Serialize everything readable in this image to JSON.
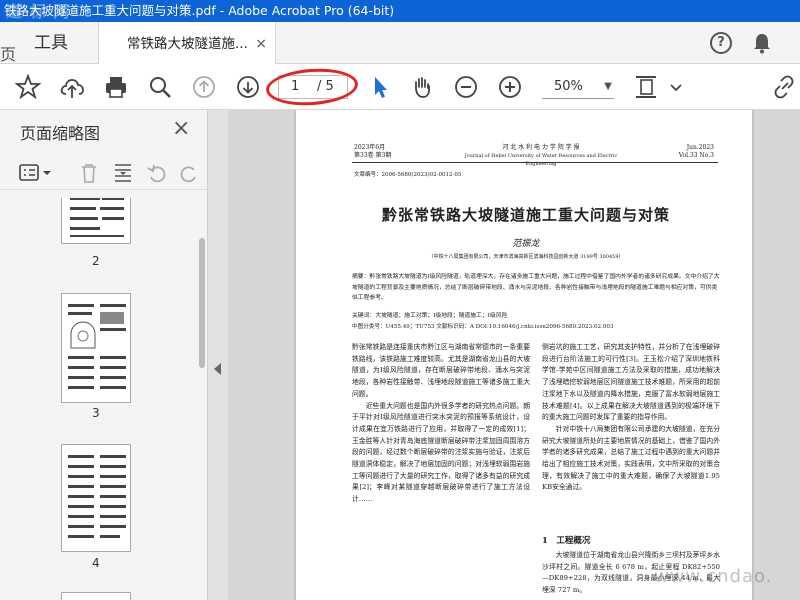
{
  "window": {
    "title": "铁路大坡隧道施工重大问题与对策.pdf - Adobe Acrobat Pro (64-bit)",
    "watermark_text": "道 标 网"
  },
  "tabs": {
    "tools_label": "工具",
    "doc_label": "常铁路大坡隧道施...",
    "close_glyph": "×",
    "help_glyph": "?"
  },
  "toolbar": {
    "current_page": "1",
    "total_pages": "/ 5",
    "zoom": "50%",
    "zoom_chevron": "▼"
  },
  "sidebar": {
    "title": "页面缩略图",
    "close_glyph": "×",
    "thumbnails": [
      {
        "label": "2"
      },
      {
        "label": "3"
      },
      {
        "label": "4"
      }
    ]
  },
  "document": {
    "header_left": [
      "2023年6月",
      "第33卷 第3期"
    ],
    "header_center": [
      "河 北 水 利 电 力 学 院 学 报",
      "Journal of Hebei University of Water Resources and Electric Engineering"
    ],
    "header_right": [
      "Jun.2023",
      "Vol.33 No.3"
    ],
    "article_no": "文章编号：2096-5680(2023)02-0012-05",
    "title": "黔张常铁路大坡隧道施工重大问题与对策",
    "author": "范振龙",
    "affiliation": "（中铁十八局集团有限公司，天津市滨海高新区滨海科技园创新大道 3199号 300459）",
    "abstract": "摘要：黔张常铁路大坡隧道为Ⅰ级风险隧道，轨道埋深大，存在诸多施工重大问题，施工过程中借鉴了国内外学者的诸多研究成果。文中介绍了大坡隧道的工程背景及主要地质情况，总结了断层破碎带地段、涌水与突泥地段、各种岩性接触带与浅埋地段的隧道施工难题与相应对策，可供类似工程参考。",
    "keywords": "关键词：大坡隧道；施工对策；I级地段；隧道施工；I级风险",
    "classification": "中图分类号：U455.49；TU753      文献标识码：A      DOI:10.16046/j.cnki.issn2096-5680.2023.02.003",
    "left_column": "黔张常铁路是连接重庆市黔江区与湖南省常德市的一条重要铁路线，该铁路施工难度较高。尤其是湖南省龙山县的大坡隧道，为Ⅰ级风险隧道，存在断层破碎带地段、涌水与突泥地段，各种岩性接触带、浅埋地段隧道施工等诸多施工重大问题。\n　　近些重大问题也是国内外很多学者的研究热点问题。朗于平针对Ⅰ级风险隧道进行突水突泥的预报等系统设计，设计成果在宜万铁路进行了应用，并取得了一定的成效[1]；王金胜等人针对青岛海底隧道断层破碎带注浆加固周围溶方段的问题，经过数个断层破碎带的注浆实施与验证，注浆后隧道洞体稳定，解决了地层加固的问题；对浅埋软弱围岩施工等问题进行了大量的研究工作，取得了诸多有益的研究成果[2]；李峰对某隧道穿越断层破碎带进行了施工方法设计……",
    "right_column": "侧岩坑的施工工艺，研究其支护特性，并分析了在浅埋破碎段进行台阶法施工的可行性[3]。王玉松介绍了深圳地铁科学馆-学苑中区间隧道施工方法及采取的措施，成功地解决了浅埋暗挖软弱地层区间隧道施工技术难题，所采用的超前注浆地下水以及隧道内降水措施，克服了富水软弱地层施工技术难题[4]。以上成果在解决大坡隧道遇到的极端环境下的重大施工问题时发挥了重要的指导作用。\n　　针对中铁十八局集团有限公司承建的大坡隧道，在充分研究大坡隧道所处的主要地质情况的基础上，借鉴了国内外学者的诸多研究成果，总结了施工过程中遇到的重大问题并给出了相应施工技术对策，实践表明，文中所采取的对策合理，有效解决了施工中的重大难题，确保了大坡隧道1.95 KB安全通过。",
    "section_heading": "1　工程概况",
    "section_text": "　　大坡隧道位于湖南省龙山县兴隆街乡三坝村及茅坪乡水沙坪村之间。隧道全长 6 678 m，起止里程 DK82+550—DK89+228，为双线隧道，洞身最小埋深 44 m，最大埋深 727 m。"
  },
  "footer_watermark": "www.cndao."
}
